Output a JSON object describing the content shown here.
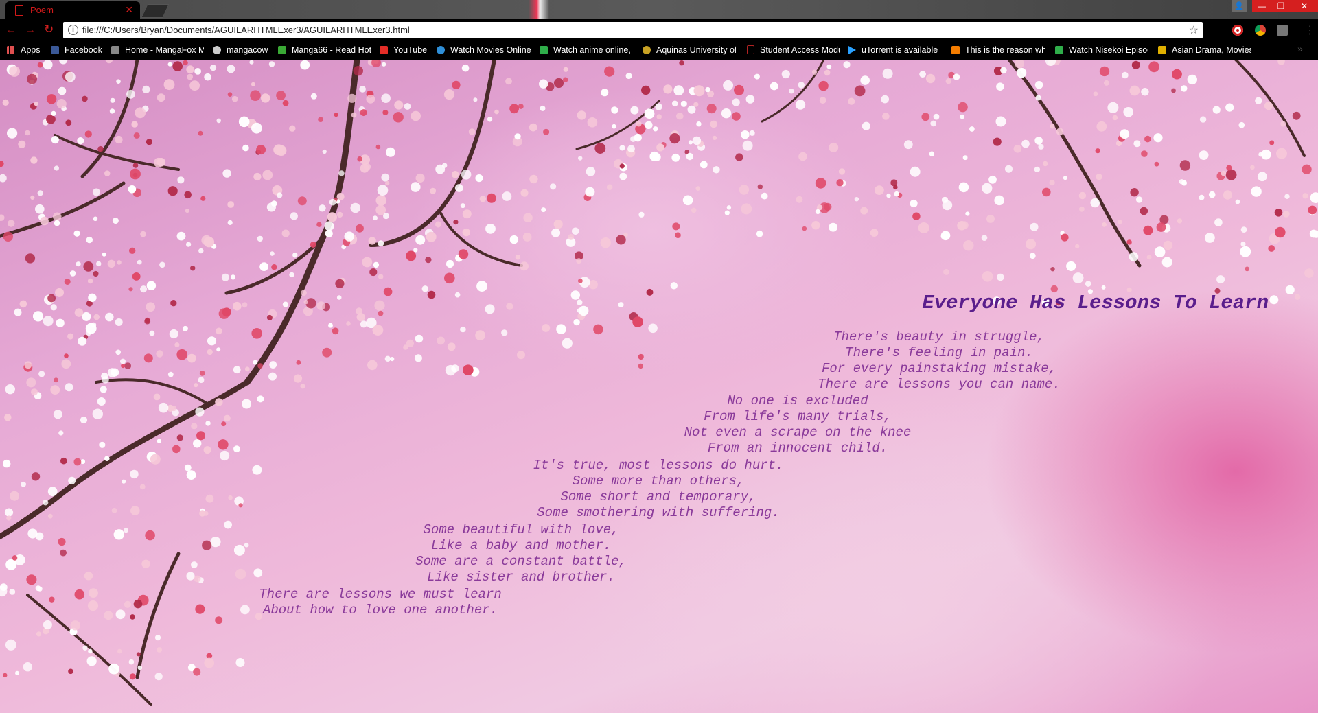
{
  "browser": {
    "tab_title": "Poem",
    "url": "file:///C:/Users/Bryan/Documents/AGUILARHTMLExer3/AGUILARHTMLExer3.html"
  },
  "bookmarks": [
    {
      "label": "Apps",
      "icon": "apps-grid-icon",
      "color": "#e04f4f"
    },
    {
      "label": "Facebook",
      "icon": "facebook-icon",
      "color": "#3b5998"
    },
    {
      "label": "Home - MangaFox M",
      "icon": "mangafox-icon",
      "color": "#888888"
    },
    {
      "label": "mangacow",
      "icon": "mangacow-icon",
      "color": "#cccccc"
    },
    {
      "label": "Manga66 - Read Hot",
      "icon": "manga66-icon",
      "color": "#3aa935"
    },
    {
      "label": "YouTube",
      "icon": "youtube-icon",
      "color": "#e52d27"
    },
    {
      "label": "Watch Movies Online",
      "icon": "movies-icon",
      "color": "#2f8fd8"
    },
    {
      "label": "Watch anime online,",
      "icon": "anime-icon",
      "color": "#2fae4a"
    },
    {
      "label": "Aquinas University of",
      "icon": "aquinas-icon",
      "color": "#c9a224"
    },
    {
      "label": "Student Access Modu",
      "icon": "document-icon",
      "color": "#b22222"
    },
    {
      "label": "uTorrent is available",
      "icon": "play-icon",
      "color": "#2aa1ff"
    },
    {
      "label": "This is the reason wh",
      "icon": "blogger-icon",
      "color": "#f57d00"
    },
    {
      "label": "Watch Nisekoi Episod",
      "icon": "nisekoi-icon",
      "color": "#2fae4a"
    },
    {
      "label": "Asian Drama, Movies",
      "icon": "asian-drama-icon",
      "color": "#e0b000"
    }
  ],
  "poem": {
    "title": "Everyone Has Lessons To Learn",
    "stanzas": [
      [
        "There's beauty in struggle,",
        "There's feeling in pain.",
        "For every painstaking mistake,",
        "There are lessons you can name."
      ],
      [
        "No one is excluded",
        "From life's many trials,",
        "Not even a scrape on the knee",
        "From an innocent child."
      ],
      [
        "It's true, most lessons do hurt.",
        "Some more than others,",
        "Some short and temporary,",
        "Some smothering with suffering."
      ],
      [
        "Some beautiful with love,",
        "Like a baby and mother.",
        "Some are a constant battle,",
        "Like sister and brother."
      ],
      [
        "There are lessons we must learn",
        "About how to love one another."
      ]
    ]
  },
  "colors": {
    "title": "#5a1e8c",
    "poem_text": "#8a3a9a",
    "chrome_accent": "#d21a1a"
  }
}
